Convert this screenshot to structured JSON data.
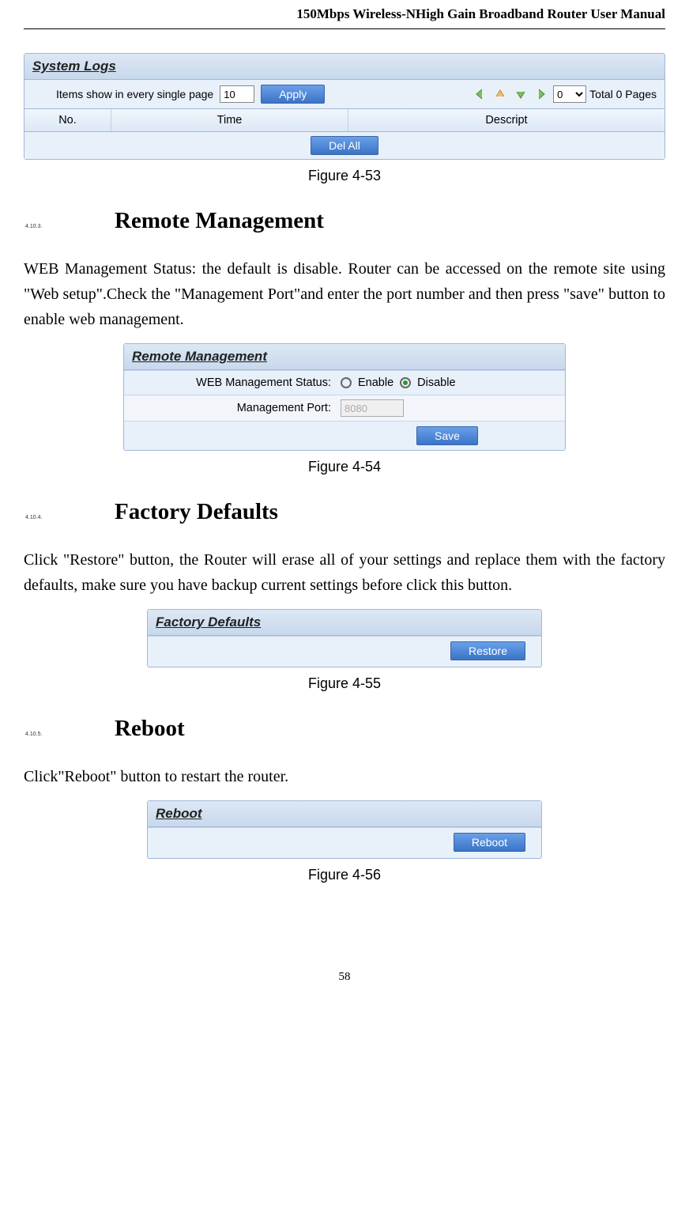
{
  "header": "150Mbps Wireless-NHigh Gain Broadband Router User Manual",
  "syslogs": {
    "title": "System Logs",
    "items_label": "Items show in every single page",
    "items_value": "10",
    "apply_label": "Apply",
    "page_select": "0",
    "total_text": "Total 0 Pages",
    "col_no": "No.",
    "col_time": "Time",
    "col_desc": "Descript",
    "delall_label": "Del All"
  },
  "fig1": "Figure 4-53",
  "section2": {
    "num": "4.10.3.",
    "title": "Remote Management",
    "para": "WEB Management Status: the default is disable. Router can be accessed on the remote site using \"Web setup\".Check the \"Management Port\"and enter the port number and then press \"save\" button to enable web management."
  },
  "remote": {
    "title": "Remote Management",
    "status_label": "WEB Management Status:",
    "enable": "Enable",
    "disable": "Disable",
    "port_label": "Management Port:",
    "port_value": "8080",
    "save_label": "Save"
  },
  "fig2": "Figure 4-54",
  "section3": {
    "num": "4.10.4.",
    "title": "Factory Defaults",
    "para": "Click \"Restore\" button, the Router will erase all of your settings and replace them with the factory defaults, make sure you have backup current settings before click this button."
  },
  "factory": {
    "title": "Factory Defaults",
    "restore_label": "Restore"
  },
  "fig3": "Figure 4-55",
  "section4": {
    "num": "4.10.5.",
    "title": "Reboot",
    "para": "Click\"Reboot\" button to restart the router."
  },
  "reboot": {
    "title": "Reboot",
    "reboot_label": "Reboot"
  },
  "fig4": "Figure 4-56",
  "page_num": "58"
}
